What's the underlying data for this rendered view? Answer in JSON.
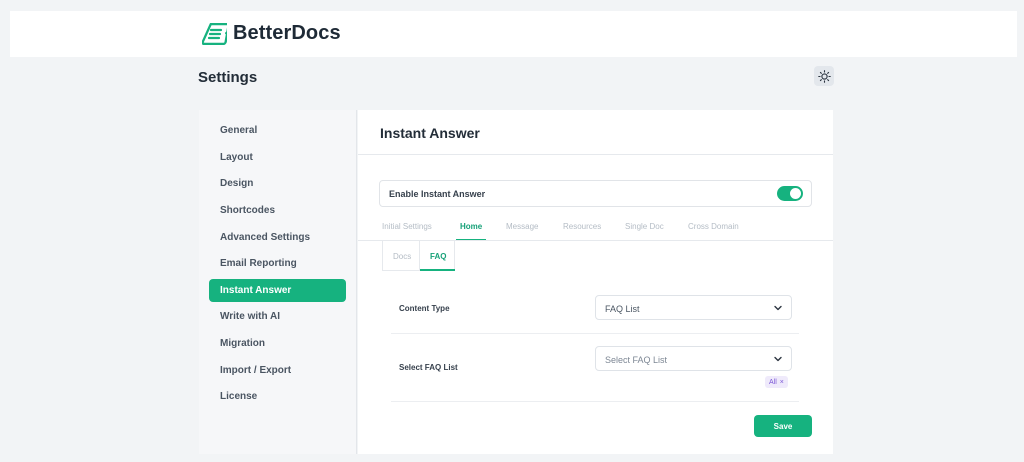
{
  "brand": {
    "name": "BetterDocs"
  },
  "header": {
    "title": "Settings",
    "theme_icon": "sun-icon"
  },
  "sidebar": {
    "items": [
      {
        "label": "General"
      },
      {
        "label": "Layout"
      },
      {
        "label": "Design"
      },
      {
        "label": "Shortcodes"
      },
      {
        "label": "Advanced Settings"
      },
      {
        "label": "Email Reporting"
      },
      {
        "label": "Instant Answer",
        "active": true
      },
      {
        "label": "Write with AI"
      },
      {
        "label": "Migration"
      },
      {
        "label": "Import / Export"
      },
      {
        "label": "License"
      }
    ]
  },
  "panel": {
    "title": "Instant Answer",
    "enable": {
      "label": "Enable Instant Answer",
      "on": true
    },
    "tabs": [
      {
        "label": "Initial Settings"
      },
      {
        "label": "Home",
        "active": true
      },
      {
        "label": "Message"
      },
      {
        "label": "Resources"
      },
      {
        "label": "Single Doc"
      },
      {
        "label": "Cross Domain"
      }
    ],
    "subtabs": [
      {
        "label": "Docs"
      },
      {
        "label": "FAQ",
        "active": true
      }
    ],
    "fields": {
      "content_type": {
        "label": "Content Type",
        "value": "FAQ List"
      },
      "select_faq": {
        "label": "Select FAQ List",
        "placeholder": "Select FAQ List",
        "chip": "All",
        "chip_remove": "×"
      }
    },
    "save_label": "Save"
  },
  "colors": {
    "accent": "#16b27f",
    "chip_text": "#7a56d6"
  }
}
